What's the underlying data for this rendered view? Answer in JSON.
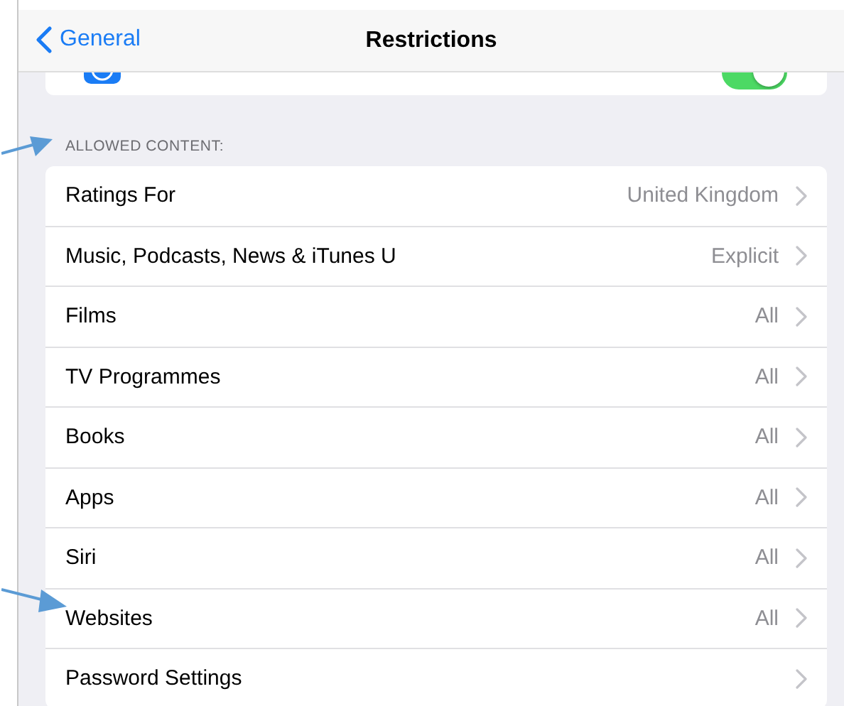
{
  "nav_bar": {
    "back": "General",
    "title": "Restrictions"
  },
  "top_row": {
    "toggle_on": true
  },
  "section": {
    "header": "ALLOWED CONTENT:",
    "rows": [
      {
        "label": "Ratings For",
        "value": "United Kingdom"
      },
      {
        "label": "Music, Podcasts, News & iTunes U",
        "value": "Explicit"
      },
      {
        "label": "Films",
        "value": "All"
      },
      {
        "label": "TV Programmes",
        "value": "All"
      },
      {
        "label": "Books",
        "value": "All"
      },
      {
        "label": "Apps",
        "value": "All"
      },
      {
        "label": "Siri",
        "value": "All"
      },
      {
        "label": "Websites",
        "value": "All"
      },
      {
        "label": "Password Settings"
      }
    ]
  }
}
